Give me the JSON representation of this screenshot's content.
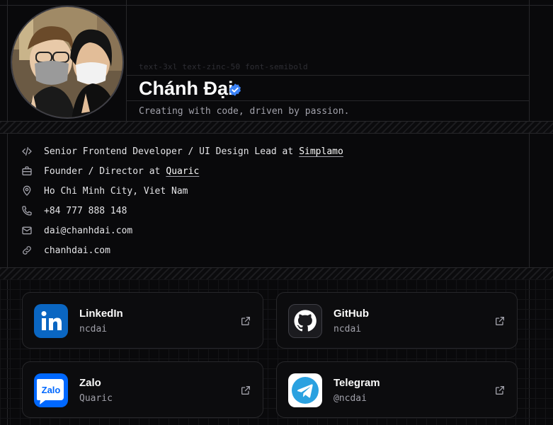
{
  "profile": {
    "class_hint": "text-3xl text-zinc-50 font-semibold",
    "name": "Chánh Đại",
    "tagline": "Creating with code, driven by passion."
  },
  "info": {
    "job1": {
      "text": "Senior Frontend Developer / UI Design Lead at",
      "link": "Simplamo"
    },
    "job2": {
      "text": "Founder / Director at",
      "link": "Quaric"
    },
    "location": "Ho Chi Minh City, Viet Nam",
    "phone": "+84 777 888 148",
    "email": "dai@chanhdai.com",
    "website": "chanhdai.com"
  },
  "social": [
    {
      "title": "LinkedIn",
      "handle": "ncdai",
      "icon": "linkedin-logo",
      "color": "#0a66c2"
    },
    {
      "title": "GitHub",
      "handle": "ncdai",
      "icon": "github-logo",
      "color": "#1b1b1f"
    },
    {
      "title": "Zalo",
      "handle": "Quaric",
      "icon": "zalo-logo",
      "color": "#0068ff"
    },
    {
      "title": "Telegram",
      "handle": "@ncdai",
      "icon": "telegram-logo",
      "color": "#2aa1e0"
    }
  ],
  "colors": {
    "background": "#09090b",
    "border": "#27272a",
    "verified": "#3b82f6"
  }
}
